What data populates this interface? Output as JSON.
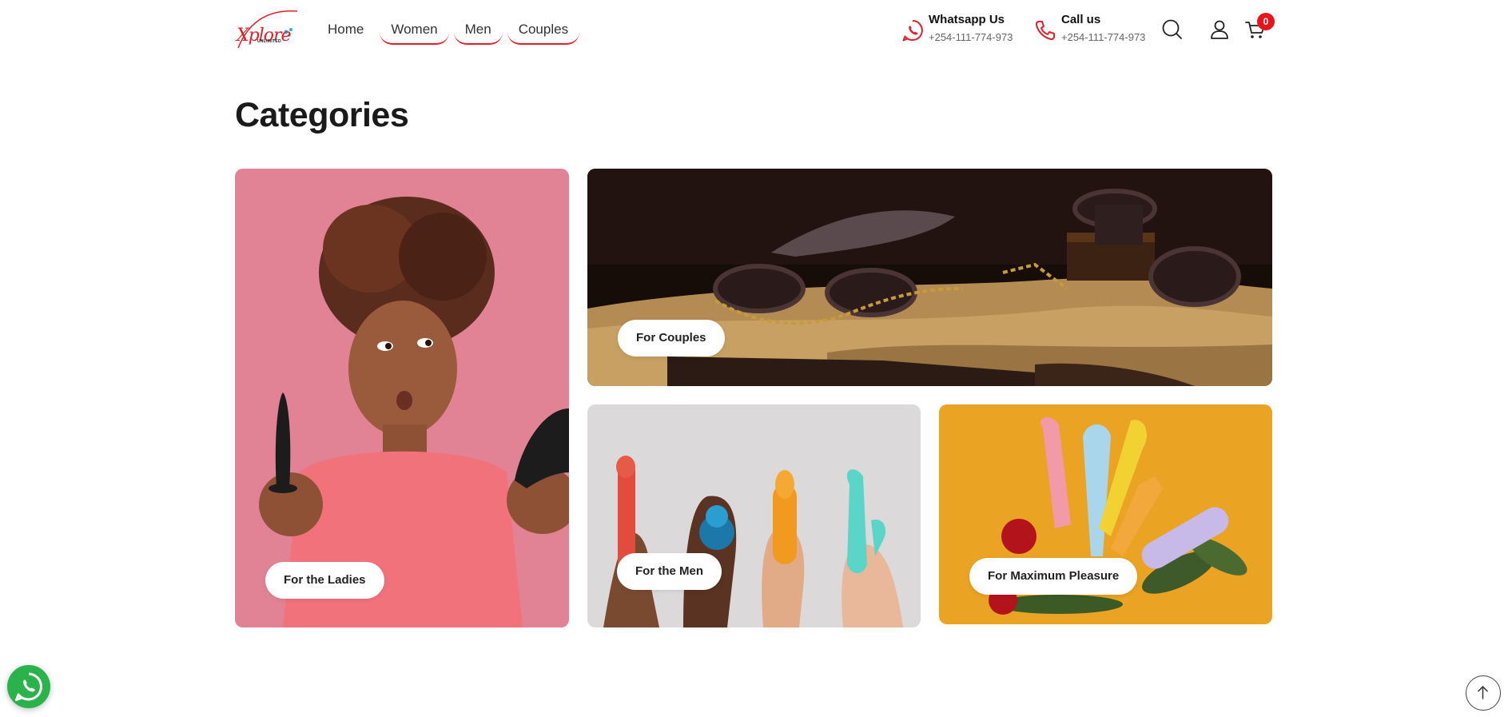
{
  "brand": {
    "logo_text": "Xplore",
    "logo_sub": "UNLIMITED"
  },
  "nav": {
    "items": [
      {
        "label": "Home"
      },
      {
        "label": "Women"
      },
      {
        "label": "Men"
      },
      {
        "label": "Couples"
      }
    ]
  },
  "contacts": {
    "whatsapp": {
      "label": "Whatsapp Us",
      "number": "+254-111-774-973"
    },
    "call": {
      "label": "Call us",
      "number": "+254-111-774-973"
    }
  },
  "cart": {
    "count": "0"
  },
  "icons": {
    "whatsapp": "whatsapp-icon",
    "phone": "phone-icon",
    "search": "search-icon",
    "account": "user-icon",
    "cart": "cart-icon",
    "scroll_top": "arrow-up-icon"
  },
  "page": {
    "title": "Categories"
  },
  "categories": [
    {
      "label": "For the Ladies"
    },
    {
      "label": "For Couples"
    },
    {
      "label": "For the Men"
    },
    {
      "label": "For Maximum Pleasure"
    }
  ],
  "colors": {
    "accent": "#e0212c",
    "badge": "#e8131b",
    "whatsapp": "#2bb34b"
  }
}
